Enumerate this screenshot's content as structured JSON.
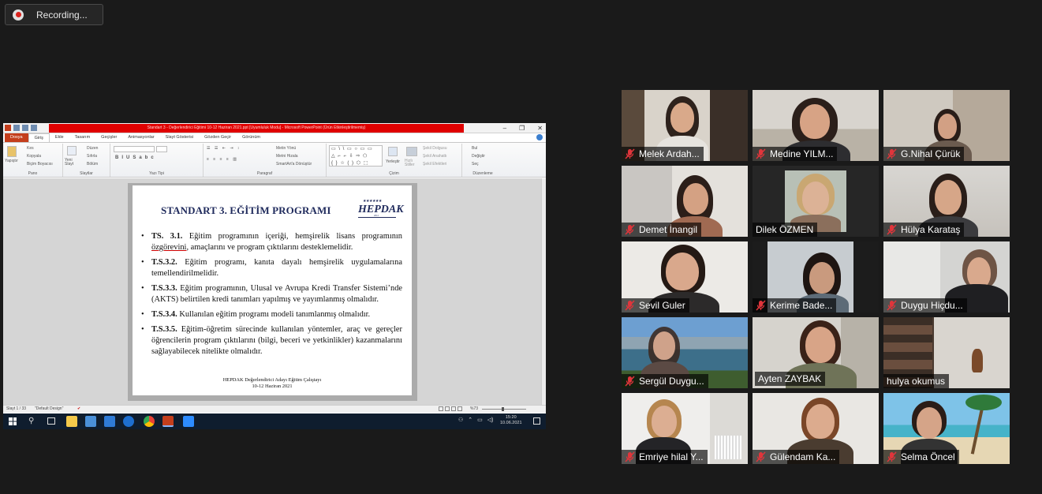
{
  "recording": {
    "label": "Recording..."
  },
  "share": {
    "window_title": "Standart 3 - Değerlendirici Eğitimi 10-12 Haziran 2021.ppt [Uyumluluk Modu] - Microsoft PowerPoint (Ürün Etkinleştirilmemiş)",
    "tabs": [
      "Dosya",
      "Giriş",
      "Ekle",
      "Tasarım",
      "Geçişler",
      "Animasyonlar",
      "Slayt Gösterisi",
      "Gözden Geçir",
      "Görünüm"
    ],
    "ribbon": {
      "clipboard": {
        "paste": "Yapıştır",
        "cut": "Kes",
        "copy": "Kopyala",
        "format_painter": "Biçim Boyacısı",
        "label": "Pano"
      },
      "slides": {
        "new_slide": "Yeni Slayt",
        "layout": "Düzen",
        "reset": "Sıfırla",
        "section": "Bölüm",
        "label": "Slaytlar"
      },
      "font": {
        "label": "Yazı Tipi"
      },
      "paragraph": {
        "text_direction": "Metin Yönü",
        "align_text": "Metni Hizala",
        "smartart": "SmartArt'a Dönüştür",
        "label": "Paragraf"
      },
      "drawing": {
        "arrange": "Yerleştir",
        "quick_styles": "Hızlı Stiller",
        "shape_fill": "Şekil Dolgusu",
        "shape_outline": "Şekil Anahattı",
        "shape_effects": "Şekil Efektleri",
        "label": "Çizim"
      },
      "editing": {
        "find": "Bul",
        "replace": "Değiştir",
        "select": "Seç",
        "label": "Düzenleme"
      }
    },
    "slide": {
      "title": "STANDART 3. EĞİTİM PROGRAMI",
      "logo": "HEPDAK",
      "logo_year": "2012",
      "bullets": [
        {
          "code": "TS. 3.1.",
          "pre": " Eğitim programının içeriği, hemşirelik lisans programının ",
          "underlined": "özgörevini",
          "post": ", amaçlarını ve program çıktılarını desteklemelidir."
        },
        {
          "code": "T.S.3.2.",
          "pre": " Eğitim programı, kanıta dayalı hemşirelik uygulamalarına temellendirilmelidir.",
          "underlined": "",
          "post": ""
        },
        {
          "code": "T.S.3.3.",
          "pre": " Eğitim programının, Ulusal ve Avrupa Kredi Transfer Sistemi’nde (AKTS) belirtilen kredi tanımları yapılmış ve yayımlanmış olmalıdır.",
          "underlined": "",
          "post": ""
        },
        {
          "code": "T.S.3.4.",
          "pre": " Kullanılan eğitim programı modeli tanımlanmış olmalıdır.",
          "underlined": "",
          "post": ""
        },
        {
          "code": "T.S.3.5.",
          "pre": " Eğitim-öğretim sürecinde kullanılan yöntemler, araç ve gereçler öğrencilerin program çıktılarını (bilgi, beceri ve yetkinlikler) kazanmalarını sağlayabilecek nitelikte olmalıdır.",
          "underlined": "",
          "post": ""
        }
      ],
      "footer_line1": "HEPDAK Değerlendirici Adayı Eğitim Çalıştayı",
      "footer_line2": "10-12 Haziran 2021"
    },
    "status": {
      "slide": "Slayt 1 / 33",
      "design": "\"Default Design\"",
      "zoom": "%73"
    },
    "taskbar": {
      "time": "15:20",
      "date": "10.06.2021"
    }
  },
  "participants": [
    {
      "name": "Melek Ardah...",
      "muted": true
    },
    {
      "name": "Medine YILM...",
      "muted": true
    },
    {
      "name": "G.Nihal Çürük",
      "muted": true
    },
    {
      "name": "Demet İnangil",
      "muted": true
    },
    {
      "name": "Dilek ÖZMEN",
      "muted": false
    },
    {
      "name": "Hülya Karataş",
      "muted": true
    },
    {
      "name": "Sevil Guler",
      "muted": true
    },
    {
      "name": "Kerime Bade...",
      "muted": true
    },
    {
      "name": "Duygu Hiçdu...",
      "muted": true
    },
    {
      "name": "Sergül Duygu...",
      "muted": true
    },
    {
      "name": "Ayten ZAYBAK",
      "muted": false,
      "speaking": true
    },
    {
      "name": "hulya okumus",
      "muted": false
    },
    {
      "name": "Emriye hilal Y...",
      "muted": true
    },
    {
      "name": "Gülendam Ka...",
      "muted": true
    },
    {
      "name": "Selma Öncel",
      "muted": true
    }
  ],
  "colors": {
    "mute_red": "#e0353b",
    "speaker_highlight": "#cfe33e",
    "powerpoint_title_red": "#e00000",
    "slide_title_navy": "#1f2a5c"
  }
}
